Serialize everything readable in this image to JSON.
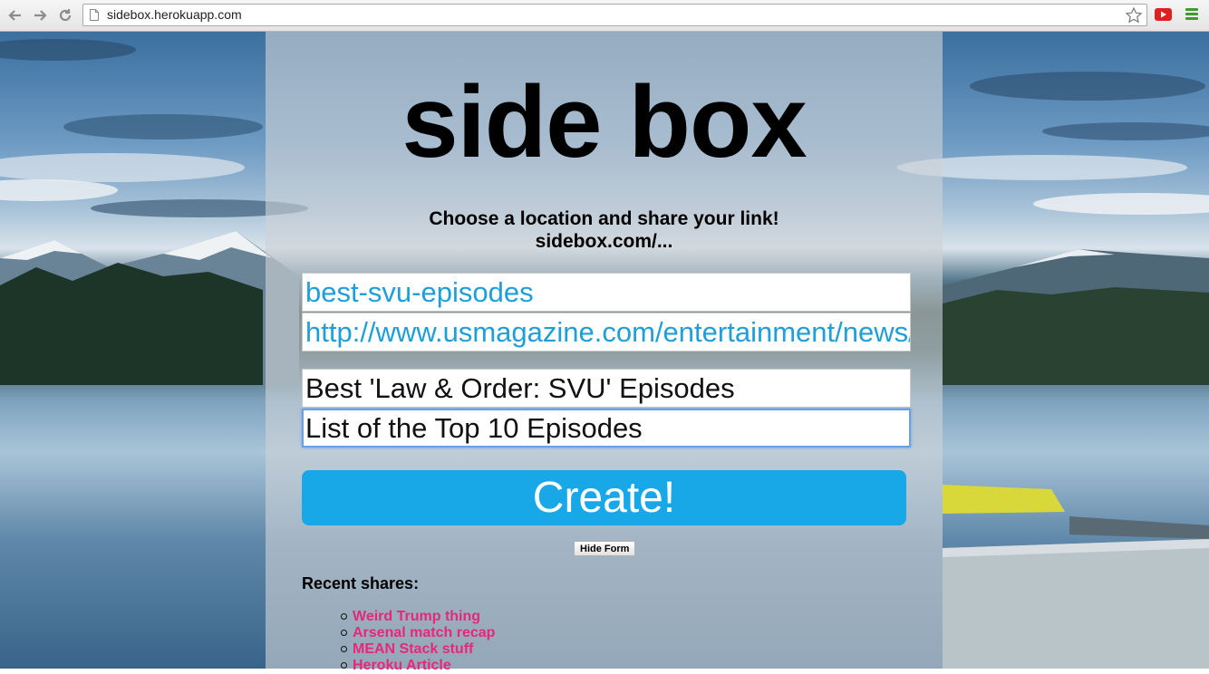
{
  "browser": {
    "url": "sidebox.herokuapp.com",
    "back_icon": "back-arrow-icon",
    "forward_icon": "forward-arrow-icon",
    "reload_icon": "reload-icon",
    "bookmark_icon": "star-icon",
    "extension_icon": "youtube-icon",
    "menu_icon": "hamburger-menu-icon"
  },
  "page": {
    "logo": "side box",
    "subtitle_line1": "Choose a location and share your link!",
    "subtitle_line2": "sidebox.com/...",
    "form": {
      "location_value": "best-svu-episodes",
      "link_value": "http://www.usmagazine.com/entertainment/news/",
      "title_value": "Best 'Law & Order: SVU' Episodes",
      "description_value": "List of the Top 10 Episodes",
      "create_label": "Create!",
      "hide_label": "Hide Form"
    },
    "recent": {
      "title": "Recent shares:",
      "items": [
        "Weird Trump thing",
        "Arsenal match recap",
        "MEAN Stack stuff",
        "Heroku Article"
      ]
    }
  },
  "colors": {
    "accent": "#18a8e8",
    "link": "#e8267a",
    "input_text": "#1f9fd9"
  }
}
